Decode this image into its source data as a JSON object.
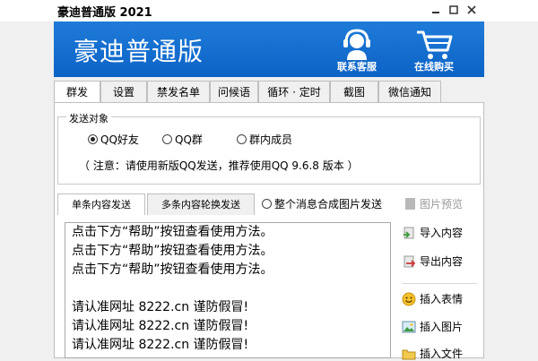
{
  "window": {
    "title": "豪迪普通版 2021"
  },
  "banner": {
    "app_name": "豪迪普通版",
    "support_label": "联系客服",
    "shop_label": "在线购买"
  },
  "main_tabs": [
    "群发",
    "设置",
    "禁发名单",
    "问候语",
    "循环 · 定时",
    "截图",
    "微信通知"
  ],
  "send_target": {
    "label": "发送对象",
    "options": [
      "QQ好友",
      "QQ群",
      "群内成员"
    ],
    "selected": "QQ好友",
    "note": "（ 注意：请使用新版QQ发送，推荐使用QQ 9.6.8 版本 ）"
  },
  "content_tabs": {
    "single": "单条内容发送",
    "multi": "多条内容轮换发送",
    "merge_option": "整个消息合成图片发送",
    "preview": "图片预览"
  },
  "editor": {
    "lines": [
      "点击下方“帮助”按钮查看使用方法。",
      "点击下方“帮助”按钮查看使用方法。",
      "点击下方“帮助”按钮查看使用方法。",
      "",
      "请认准网址 8222.cn 谨防假冒!",
      "请认准网址 8222.cn 谨防假冒!",
      "请认准网址 8222.cn 谨防假冒!"
    ]
  },
  "side_buttons": {
    "import": "导入内容",
    "export": "导出内容",
    "emoji": "插入表情",
    "image": "插入图片",
    "file": "插入文件"
  }
}
